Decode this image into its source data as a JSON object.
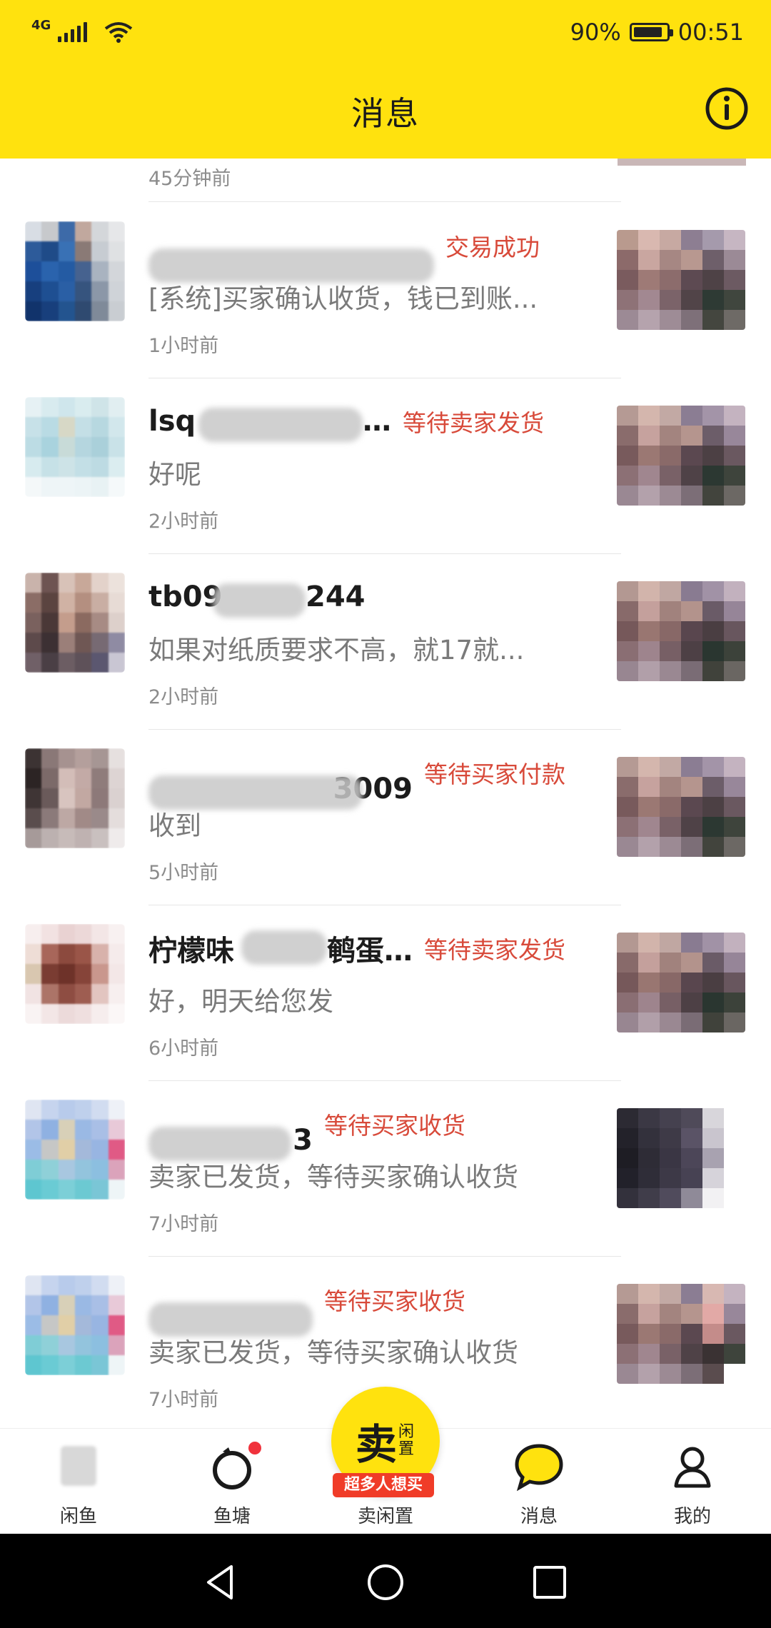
{
  "status_bar": {
    "network": "4G",
    "battery": "90%",
    "battery_level": 0.9,
    "time": "00:51"
  },
  "header": {
    "title": "消息"
  },
  "first_item": {
    "time": "45分钟前"
  },
  "conversations": [
    {
      "name": "",
      "status": "交易成功",
      "preview": "[系统]买家确认收货，钱已到账...",
      "time": "1小时前"
    },
    {
      "name": "lsq",
      "status": "等待卖家发货",
      "preview": "好呢",
      "time": "2小时前"
    },
    {
      "name": "tb09",
      "status": "",
      "preview": "如果对纸质要求不高，就17就...",
      "time": "2小时前"
    },
    {
      "name": "3009",
      "status": "等待买家付款",
      "preview": "收到",
      "time": "5小时前"
    },
    {
      "name": "柠檬味",
      "status": "等待卖家发货",
      "preview": "好，明天给您发",
      "time": "6小时前"
    },
    {
      "name": "",
      "status": "等待买家收货",
      "preview": "卖家已发货，等待买家确认收货",
      "time": "7小时前"
    },
    {
      "name": "",
      "status": "等待买家收货",
      "preview": "卖家已发货，等待买家确认收货",
      "time": "7小时前"
    }
  ],
  "bottom_nav": {
    "home": "闲鱼",
    "pond": "鱼塘",
    "sell": "卖闲置",
    "sell_main": "卖",
    "sell_sub": "闲置",
    "sell_banner": "超多人想买",
    "messages": "消息",
    "mine": "我的"
  }
}
